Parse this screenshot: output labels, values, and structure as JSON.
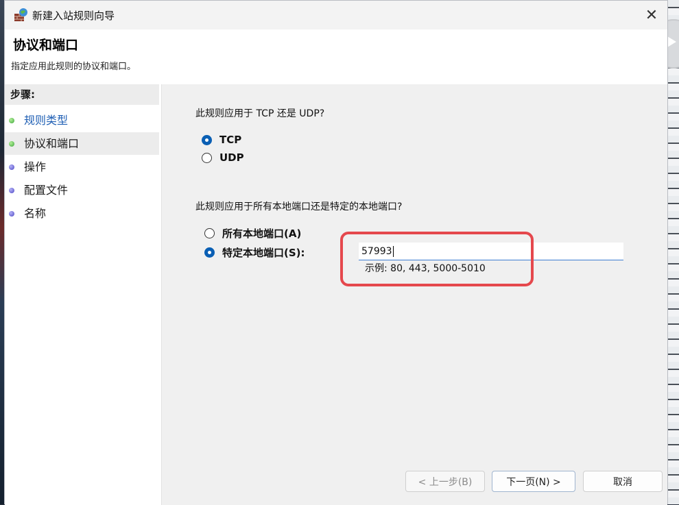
{
  "window": {
    "title": "新建入站规则向导",
    "close_glyph": "✕"
  },
  "header": {
    "title": "协议和端口",
    "subtitle": "指定应用此规则的协议和端口。"
  },
  "steps": {
    "heading": "步骤:",
    "items": [
      {
        "label": "规则类型",
        "state": "done",
        "color": "#1f5fb4"
      },
      {
        "label": "协议和端口",
        "state": "current"
      },
      {
        "label": "操作",
        "state": "pending"
      },
      {
        "label": "配置文件",
        "state": "pending"
      },
      {
        "label": "名称",
        "state": "pending"
      }
    ]
  },
  "protocol": {
    "question": "此规则应用于 TCP 还是 UDP?",
    "options": [
      {
        "label": "TCP",
        "checked": true
      },
      {
        "label": "UDP",
        "checked": false
      }
    ]
  },
  "ports": {
    "question": "此规则应用于所有本地端口还是特定的本地端口?",
    "options": [
      {
        "label": "所有本地端口(A)",
        "checked": false
      },
      {
        "label": "特定本地端口(S):",
        "checked": true
      }
    ],
    "input_value": "57993",
    "example": "示例: 80, 443, 5000-5010"
  },
  "buttons": {
    "back": "< 上一步(B)",
    "next": "下一页(N) >",
    "cancel": "取消"
  },
  "colors": {
    "accent": "#0a5fb4",
    "highlight": "#e5484d",
    "link_blue": "#1f5fb4"
  }
}
